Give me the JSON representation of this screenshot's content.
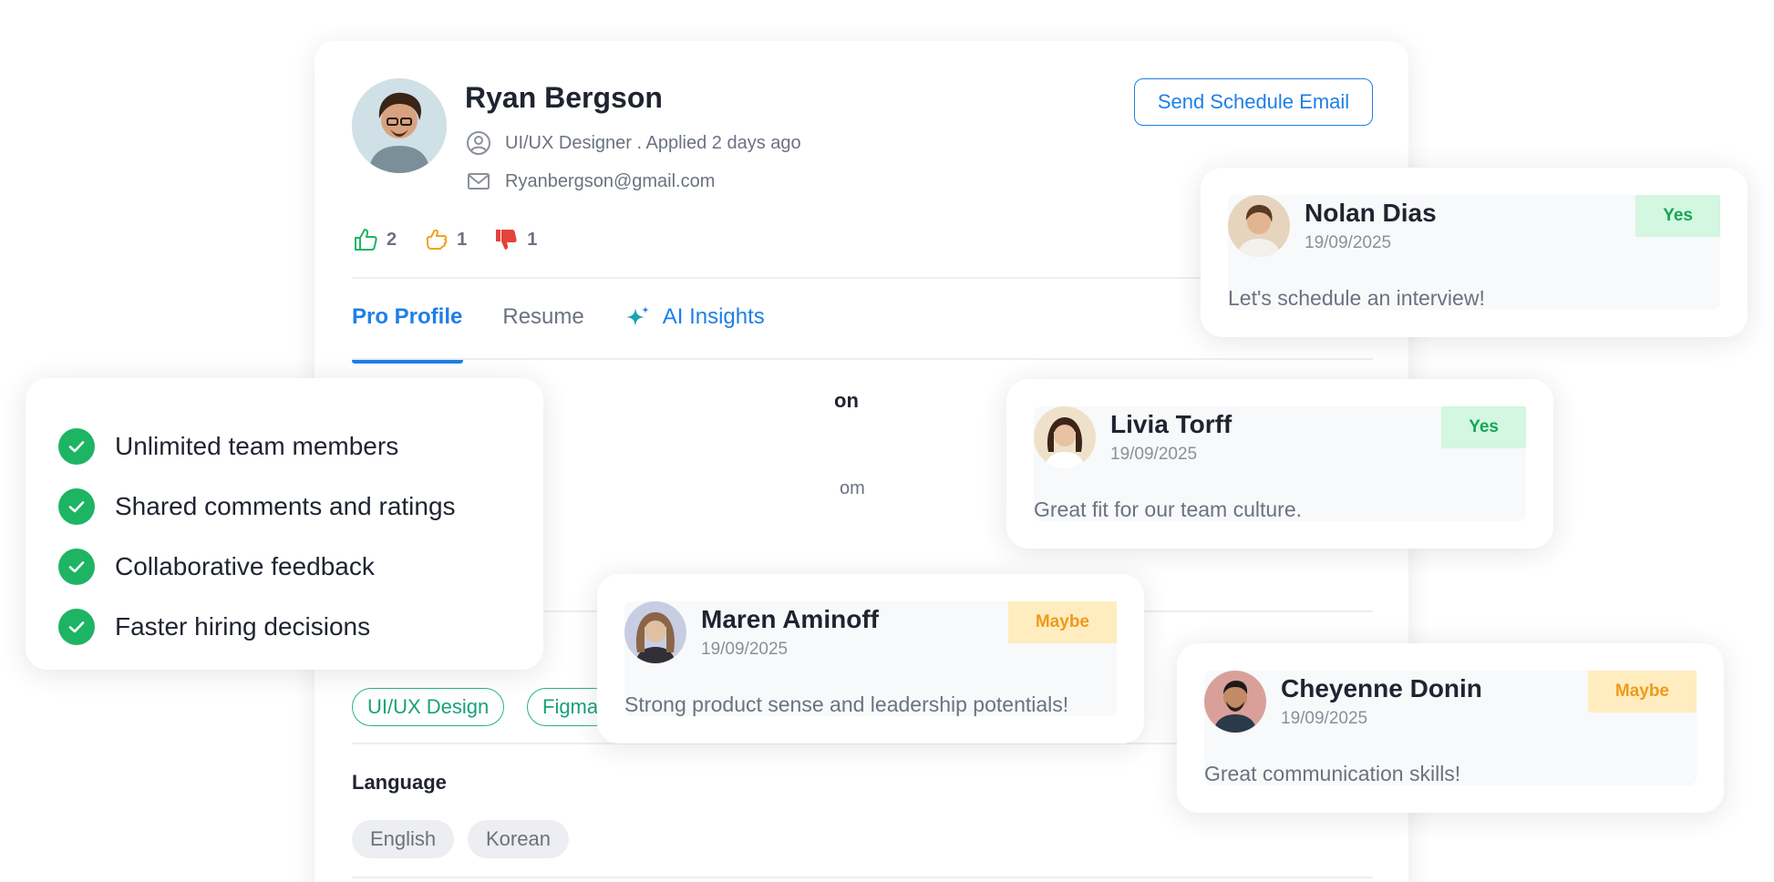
{
  "profile": {
    "name": "Ryan Bergson",
    "role_line": "UI/UX Designer . Applied 2 days ago",
    "email": "Ryanbergson@gmail.com",
    "schedule_button": "Send Schedule Email",
    "votes": {
      "thumbs_up": "2",
      "maybe": "1",
      "thumbs_down": "1"
    },
    "tabs": [
      "Pro Profile",
      "Resume",
      "AI Insights"
    ],
    "partial_heading": "on",
    "partial_email": "om",
    "skills": [
      "UI/UX Design",
      "Figma"
    ],
    "language_title": "Language",
    "languages": [
      "English",
      "Korean"
    ]
  },
  "features": [
    "Unlimited team members",
    "Shared comments and ratings",
    "Collaborative feedback",
    "Faster hiring decisions"
  ],
  "feedback": [
    {
      "name": "Nolan Dias",
      "date": "19/09/2025",
      "badge": "Yes",
      "comment": "Let's schedule an interview!"
    },
    {
      "name": "Livia Torff",
      "date": "19/09/2025",
      "badge": "Yes",
      "comment": "Great fit for our team culture."
    },
    {
      "name": "Maren Aminoff",
      "date": "19/09/2025",
      "badge": "Maybe",
      "comment": "Strong product sense and leadership potentials!"
    },
    {
      "name": "Cheyenne Donin",
      "date": "19/09/2025",
      "badge": "Maybe",
      "comment": "Great communication skills!"
    }
  ],
  "colors": {
    "accent": "#1e7fe8",
    "green": "#1db464",
    "yes_bg": "#d3f7e0",
    "maybe_bg": "#ffedc0",
    "dislike": "#e5423a",
    "maybe_icon": "#f0a31c"
  }
}
